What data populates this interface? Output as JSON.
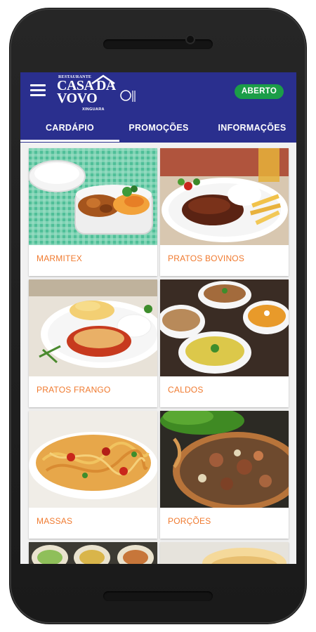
{
  "app": {
    "logo_small": "RESTAURANTE",
    "logo_name": "CASA DA VOVO",
    "logo_city": "XINGUARA",
    "status": "ABERTO"
  },
  "tabs": [
    {
      "label": "CARDÁPIO",
      "active": true
    },
    {
      "label": "PROMOÇÕES",
      "active": false
    },
    {
      "label": "INFORMAÇÕES",
      "active": false
    }
  ],
  "categories": [
    {
      "label": "MARMITEX"
    },
    {
      "label": "PRATOS BOVINOS"
    },
    {
      "label": "PRATOS FRANGO"
    },
    {
      "label": "CALDOS"
    },
    {
      "label": "MASSAS"
    },
    {
      "label": "PORÇÕES"
    }
  ],
  "colors": {
    "appbar": "#2a2f8e",
    "status_green": "#1b9d48",
    "label_orange": "#f07a2f"
  }
}
